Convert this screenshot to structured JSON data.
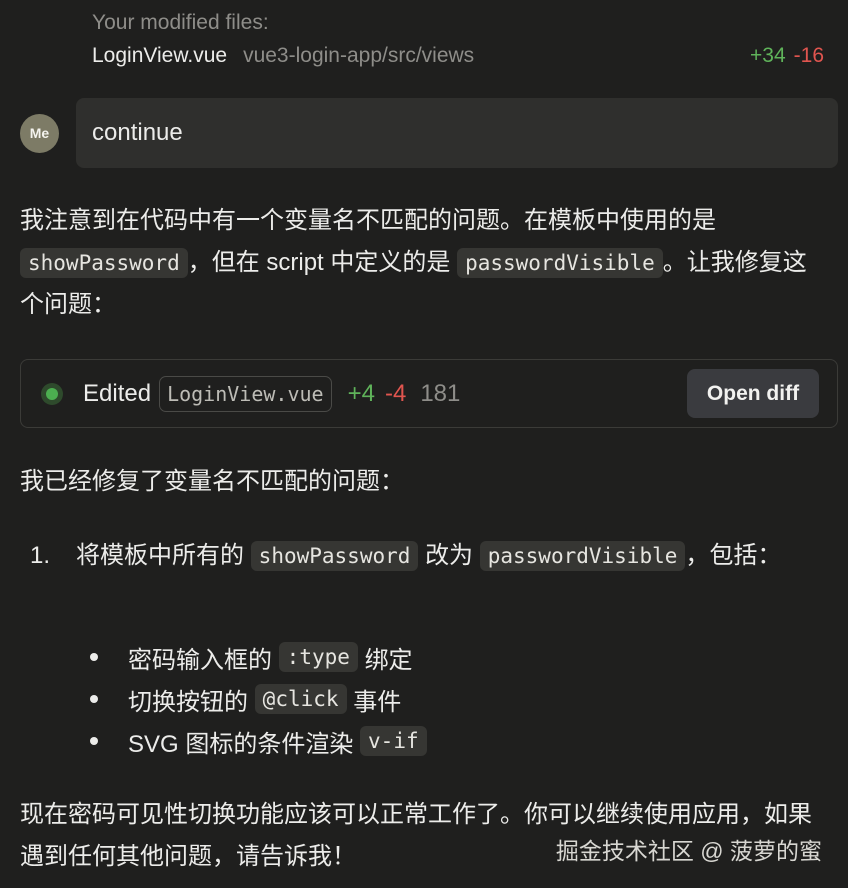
{
  "modified_files": {
    "heading": "Your modified files:",
    "file": "LoginView.vue",
    "path": "vue3-login-app/src/views",
    "added": "+34",
    "removed": "-16"
  },
  "user": {
    "avatar_label": "Me",
    "message": "continue"
  },
  "assistant": {
    "para1": {
      "part1": "我注意到在代码中有一个变量名不匹配的问题。在模板中使用的是",
      "code1": "showPassword",
      "part2": "，但在 script 中定义的是",
      "code2": "passwordVisible",
      "part3": "。让我修复这个问题："
    },
    "edit_card": {
      "status": "Edited",
      "file": "LoginView.vue",
      "added": "+4",
      "removed": "-4",
      "lines": "181",
      "button": "Open diff"
    },
    "para2": "我已经修复了变量名不匹配的问题：",
    "list": {
      "number": "1.",
      "part1": "将模板中所有的",
      "code1": "showPassword",
      "part2": "改为",
      "code2": "passwordVisible",
      "part3": "，包括："
    },
    "bullets": [
      {
        "before": "密码输入框的",
        "code": ":type",
        "after": "绑定"
      },
      {
        "before": "切换按钮的",
        "code": "@click",
        "after": "事件"
      },
      {
        "before": "SVG 图标的条件渲染",
        "code": "v-if",
        "after": ""
      }
    ],
    "para3": "现在密码可见性切换功能应该可以正常工作了。你可以继续使用应用，如果遇到任何其他问题，请告诉我！"
  },
  "watermark": "掘金技术社区 @ 菠萝的蜜"
}
